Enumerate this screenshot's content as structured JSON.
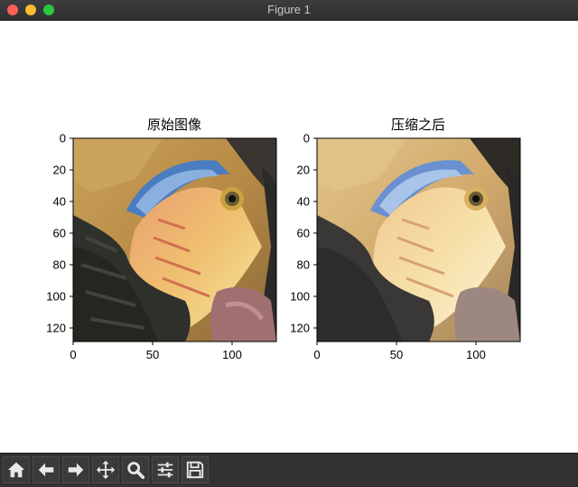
{
  "window": {
    "title": "Figure 1",
    "controls": [
      "close",
      "minimize",
      "maximize"
    ]
  },
  "figure": {
    "axes": [
      {
        "title": "原始图像",
        "xticks": [
          "0",
          "50",
          "100"
        ],
        "yticks": [
          "0",
          "20",
          "40",
          "60",
          "80",
          "100",
          "120"
        ],
        "image": "hornbill-bird-original"
      },
      {
        "title": "压缩之后",
        "xticks": [
          "0",
          "50",
          "100"
        ],
        "yticks": [
          "0",
          "20",
          "40",
          "60",
          "80",
          "100",
          "120"
        ],
        "image": "hornbill-bird-compressed"
      }
    ]
  },
  "toolbar": {
    "buttons": [
      {
        "name": "home-icon"
      },
      {
        "name": "back-arrow-icon"
      },
      {
        "name": "forward-arrow-icon"
      },
      {
        "name": "pan-move-icon"
      },
      {
        "name": "zoom-magnifier-icon"
      },
      {
        "name": "configure-subplots-icon"
      },
      {
        "name": "save-floppy-icon"
      }
    ]
  },
  "colors": {
    "titlebar": "#3d3d40",
    "toolbar": "#323234",
    "canvas": "#ffffff"
  }
}
